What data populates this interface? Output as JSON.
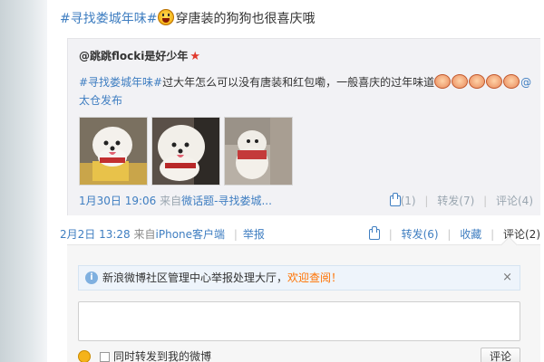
{
  "post": {
    "tag": "#寻找娄城年味#",
    "text": "穿唐装的狗狗也很喜庆哦"
  },
  "repost": {
    "author": "@跳跳flocki是好少年",
    "tag": "#寻找娄城年味#",
    "body": "过大年怎么可以没有唐装和红包嘞，一般喜庆的过年味道",
    "mention": "@太仓发布",
    "time": "1月30日 19:06",
    "from_prefix": "来自",
    "from_source": "微话题-寻找娄城...",
    "likes": "(1)",
    "repost_label": "转发(7)",
    "comment_label": "评论(4)"
  },
  "footer": {
    "time": "2月2日 13:28",
    "from_prefix": "来自",
    "source": "iPhone客户端",
    "report": "举报",
    "repost_label": "转发(6)",
    "favorite_label": "收藏",
    "comment_label": "评论(2)"
  },
  "comment": {
    "notice": "新浪微博社区管理中心举报处理大厅，",
    "notice_link": "欢迎查阅！",
    "close": "×",
    "input_value": "",
    "checkbox_label": "同时转发到我的微博",
    "submit": "评论"
  },
  "colors": {
    "link": "#3f7ec1",
    "muted": "#9aa6b0",
    "accent_orange": "#ff7200"
  }
}
